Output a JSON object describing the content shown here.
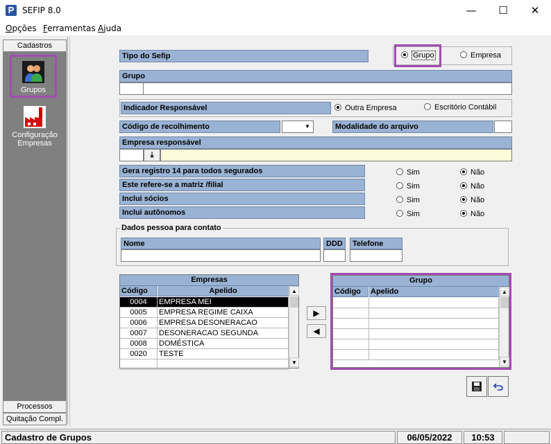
{
  "window": {
    "title": "SEFIP 8.0",
    "icon_letter": "P",
    "minimize": "—",
    "maximize": "☐",
    "close": "✕"
  },
  "menu": {
    "opcoes": "Opções",
    "ferramentas": "Ferramentas",
    "ajuda": "Ajuda"
  },
  "sidebar": {
    "cadastros": "Cadastros",
    "grupos": "Grupos",
    "configuracao_1": "Configuração",
    "configuracao_2": "Empresas",
    "processos": "Processos",
    "quitacao": "Quitação Compl."
  },
  "form": {
    "tipo_sefip": "Tipo do Sefip",
    "opt_grupo": "Grupo",
    "opt_empresa": "Empresa",
    "grupo_label": "Grupo",
    "grupo_code": "",
    "grupo_name": "",
    "indicador": "Indicador Responsável",
    "opt_outra": "Outra Empresa",
    "opt_escritorio": "Escritório Contábil",
    "codigo_recolhimento": "Código de recolhimento",
    "codigo_recolhimento_value": "",
    "modalidade": "Modalidade do arquivo",
    "modalidade_value": "",
    "empresa_resp": "Empresa responsável",
    "empresa_resp_code": "",
    "empresa_resp_name": "",
    "q1": "Gera registro 14 para todos segurados",
    "q2": "Este refere-se a matriz /filial",
    "q3": "Inclui sócios",
    "q4": "Inclui autônomos",
    "sim": "Sim",
    "nao": "Não",
    "contato_title": "Dados pessoa para contato",
    "nome": "Nome",
    "ddd": "DDD",
    "telefone": "Telefone"
  },
  "empresas_grid": {
    "title": "Empresas",
    "col_codigo": "Código",
    "col_apelido": "Apelido",
    "rows": [
      {
        "codigo": "0004",
        "apelido": "EMPRESA MEI",
        "selected": true
      },
      {
        "codigo": "0005",
        "apelido": "EMPRESA REGIME CAIXA",
        "selected": false
      },
      {
        "codigo": "0006",
        "apelido": "EMPRESA DESONERACAO",
        "selected": false
      },
      {
        "codigo": "0007",
        "apelido": "DESONERACAO SEGUNDA",
        "selected": false
      },
      {
        "codigo": "0008",
        "apelido": "DOMÉSTICA",
        "selected": false
      },
      {
        "codigo": "0020",
        "apelido": "TESTE",
        "selected": false
      },
      {
        "codigo": "",
        "apelido": "",
        "selected": false
      }
    ]
  },
  "grupo_grid": {
    "title": "Grupo",
    "col_codigo": "Código",
    "col_apelido": "Apelido"
  },
  "status": {
    "text": "Cadastro de Grupos",
    "date": "06/05/2022",
    "time": "10:53"
  },
  "colors": {
    "label_bg": "#9ab3d4",
    "highlight": "#a24cb0",
    "yellow_field": "#fdfbd9"
  }
}
